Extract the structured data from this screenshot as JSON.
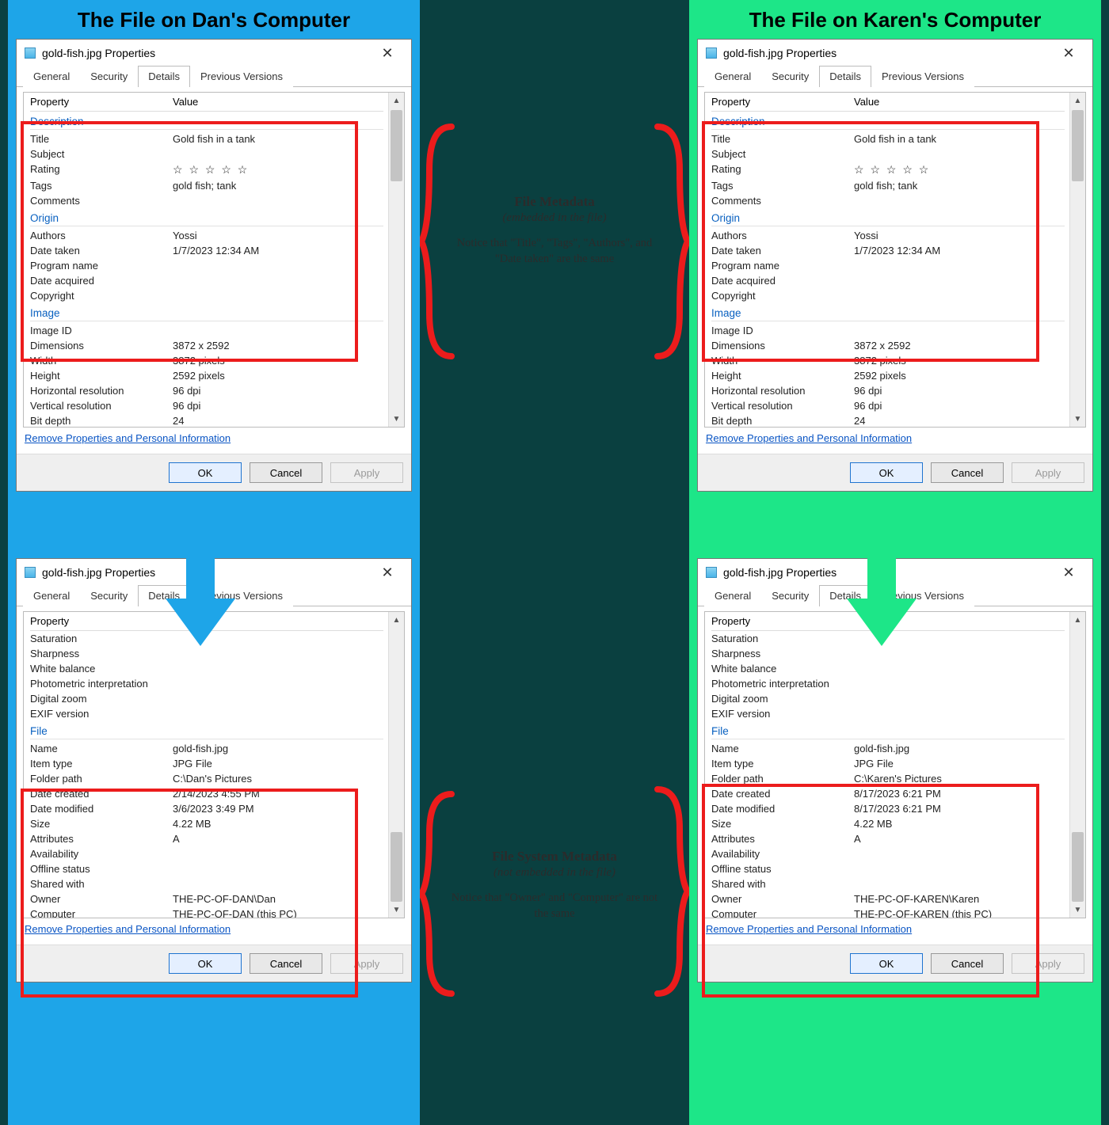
{
  "titles": {
    "dan": "The File on Dan's Computer",
    "karen": "The File on Karen's Computer"
  },
  "center": {
    "top": {
      "line1": "File Metadata",
      "line2": "(embedded in the file)",
      "line3": "Notice that \"Title\", \"Tags\", \"Authors\", and \"Date taken\" are the same"
    },
    "bottom": {
      "line1": "File System Metadata",
      "line2": "(not embedded in the file)",
      "line3": "Notice that \"Owner\" and \"Computer\" are not the same"
    }
  },
  "dialog": {
    "title": "gold-fish.jpg Properties",
    "tabs": {
      "general": "General",
      "security": "Security",
      "details": "Details",
      "previous": "Previous Versions"
    },
    "header": {
      "property": "Property",
      "value": "Value"
    },
    "remove_link": "Remove Properties and Personal Information",
    "buttons": {
      "ok": "OK",
      "cancel": "Cancel",
      "apply": "Apply"
    }
  },
  "sections": {
    "description": "Description",
    "origin": "Origin",
    "image": "Image",
    "file": "File"
  },
  "labels": {
    "title": "Title",
    "subject": "Subject",
    "rating": "Rating",
    "tags": "Tags",
    "comments": "Comments",
    "authors": "Authors",
    "date_taken": "Date taken",
    "program_name": "Program name",
    "date_acquired": "Date acquired",
    "copyright": "Copyright",
    "image_id": "Image ID",
    "dimensions": "Dimensions",
    "width": "Width",
    "height": "Height",
    "hres": "Horizontal resolution",
    "vres": "Vertical resolution",
    "bit_depth": "Bit depth",
    "saturation": "Saturation",
    "sharpness": "Sharpness",
    "white_balance": "White balance",
    "photometric": "Photometric interpretation",
    "digital_zoom": "Digital zoom",
    "exif": "EXIF version",
    "name": "Name",
    "item_type": "Item type",
    "folder_path": "Folder path",
    "date_created": "Date created",
    "date_modified": "Date modified",
    "size": "Size",
    "attributes": "Attributes",
    "availability": "Availability",
    "offline": "Offline status",
    "shared_with": "Shared with",
    "owner": "Owner",
    "computer": "Computer"
  },
  "shared_meta": {
    "title": "Gold fish in a tank",
    "subject": "",
    "rating_stars": "☆ ☆ ☆ ☆ ☆",
    "tags": "gold fish; tank",
    "comments": "",
    "authors": "Yossi",
    "date_taken": "1/7/2023 12:34 AM",
    "program_name": "",
    "date_acquired": "",
    "copyright": "",
    "image_id": "",
    "dimensions": "3872 x 2592",
    "width": "3872 pixels",
    "height": "2592 pixels",
    "hres": "96 dpi",
    "vres": "96 dpi",
    "bit_depth": "24"
  },
  "file_common": {
    "name": "gold-fish.jpg",
    "item_type": "JPG File",
    "size": "4.22 MB",
    "attributes": "A",
    "availability": "",
    "offline": "",
    "shared_with": ""
  },
  "dan_file": {
    "folder_path": "C:\\Dan's Pictures",
    "date_created": "2/14/2023 4:55 PM",
    "date_modified": "3/6/2023 3:49 PM",
    "owner": "THE-PC-OF-DAN\\Dan",
    "computer": "THE-PC-OF-DAN (this PC)"
  },
  "karen_file": {
    "folder_path": "C:\\Karen's Pictures",
    "date_created": "8/17/2023 6:21 PM",
    "date_modified": "8/17/2023 6:21 PM",
    "owner": "THE-PC-OF-KAREN\\Karen",
    "computer": "THE-PC-OF-KAREN (this PC)"
  },
  "bottom_extras": {
    "property": "Property",
    "saturation": "Saturation"
  }
}
